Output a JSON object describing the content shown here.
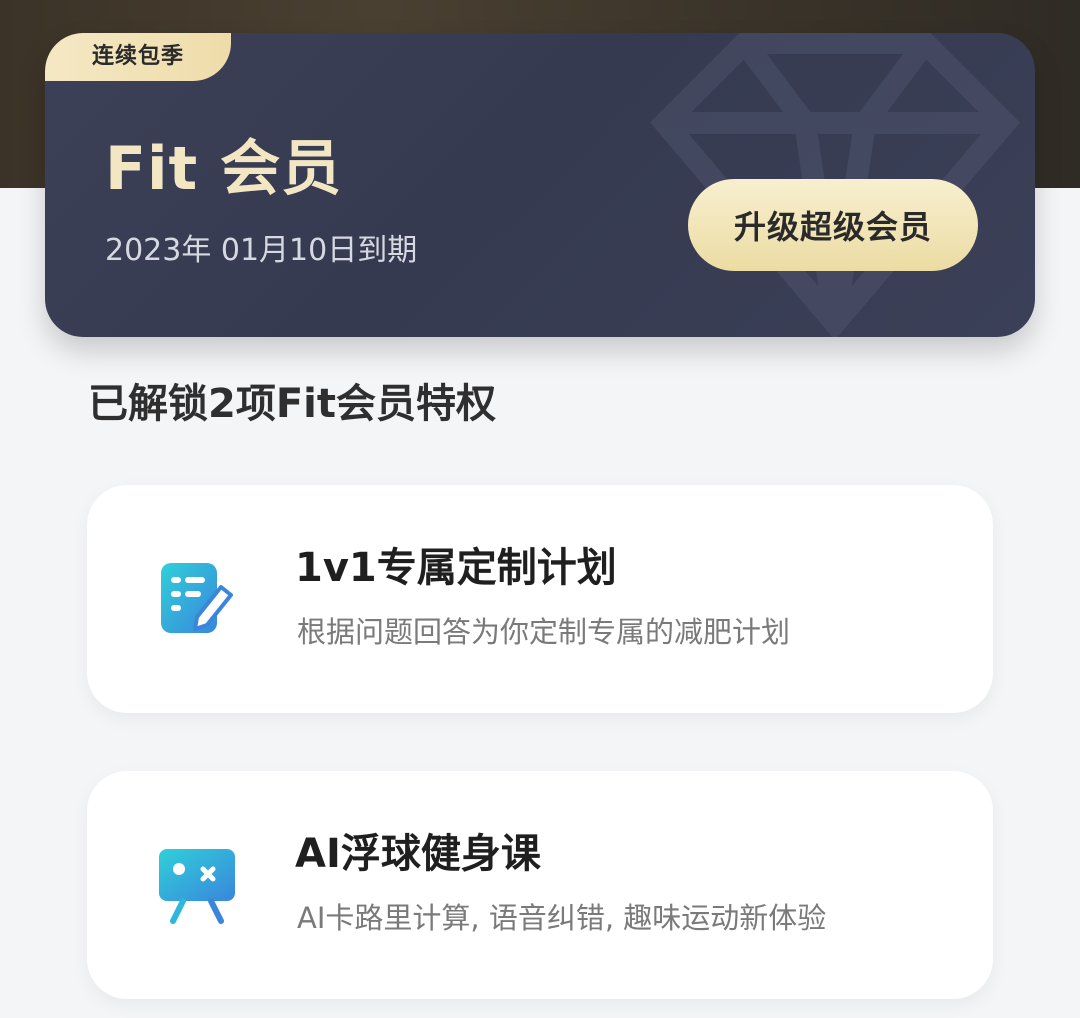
{
  "membership": {
    "badge": "连续包季",
    "title": "Fit 会员",
    "expiry": "2023年 01月10日到期",
    "upgrade_label": "升级超级会员"
  },
  "section": {
    "title": "已解锁2项Fit会员特权"
  },
  "benefits": [
    {
      "title": "1v1专属定制计划",
      "description": "根据问题回答为你定制专属的减肥计划",
      "icon": "plan-edit-icon"
    },
    {
      "title": "AI浮球健身课",
      "description": "AI卡路里计算, 语音纠错, 趣味运动新体验",
      "icon": "presentation-board-icon"
    }
  ],
  "colors": {
    "card_bg": "#3a3f56",
    "gold_accent": "#efdcaa",
    "gold_text": "#f3e6c2",
    "icon_gradient_start": "#27c7d6",
    "icon_gradient_end": "#3b7fd8"
  }
}
